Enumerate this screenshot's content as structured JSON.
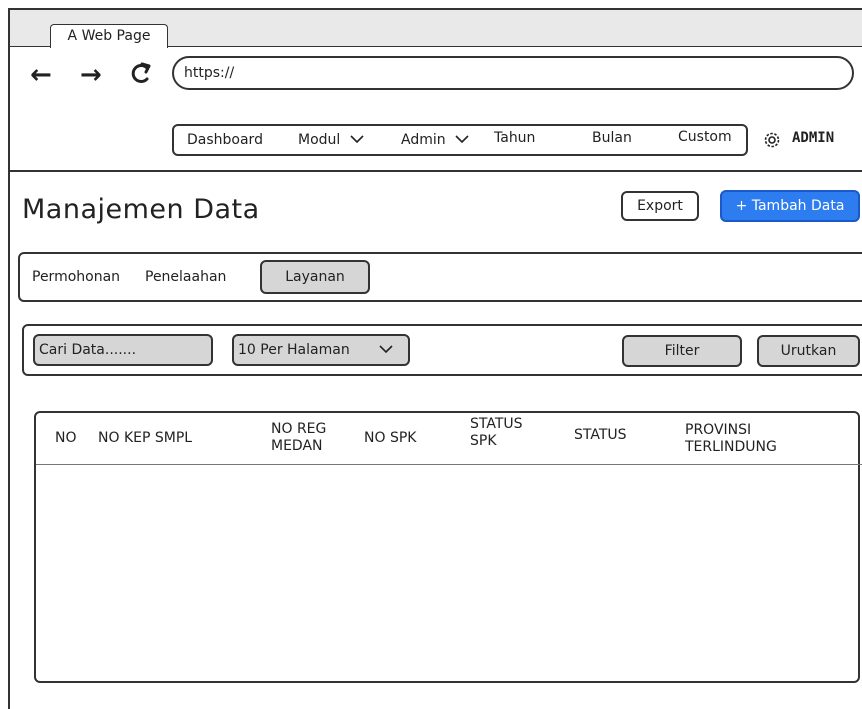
{
  "browser": {
    "tab_title": "A Web Page",
    "back_icon": "←",
    "forward_icon": "→",
    "reload_icon": "C",
    "url": "https://"
  },
  "navbar": {
    "items": [
      {
        "label": "Dashboard"
      },
      {
        "label": "Modul"
      },
      {
        "label": "Admin"
      },
      {
        "label": "Tahun"
      },
      {
        "label": "Bulan"
      },
      {
        "label": "Custom"
      }
    ],
    "user_label": "ADMIN",
    "gear_icon": "gear-icon"
  },
  "page": {
    "title": "Manajemen Data",
    "export_label": "Export",
    "add_label": "+ Tambah Data"
  },
  "tabs": {
    "items": [
      "Permohonan",
      "Penelaahan",
      "Layanan"
    ],
    "active": "Layanan"
  },
  "filters": {
    "search_placeholder": "Cari Data.......",
    "per_page": "10 Per Halaman",
    "filter_label": "Filter",
    "sort_label": "Urutkan"
  },
  "table": {
    "columns": [
      {
        "line1": "NO",
        "line2": ""
      },
      {
        "line1": "NO KEP SMPL",
        "line2": ""
      },
      {
        "line1": "NO REG",
        "line2": "MEDAN"
      },
      {
        "line1": "NO SPK",
        "line2": ""
      },
      {
        "line1": "STATUS",
        "line2": "SPK"
      },
      {
        "line1": "STATUS",
        "line2": ""
      },
      {
        "line1": "PROVINSI",
        "line2": "TERLINDUNG"
      }
    ]
  },
  "colors": {
    "primary": "#2d7cf0",
    "muted_fill": "#d6d6d6"
  }
}
